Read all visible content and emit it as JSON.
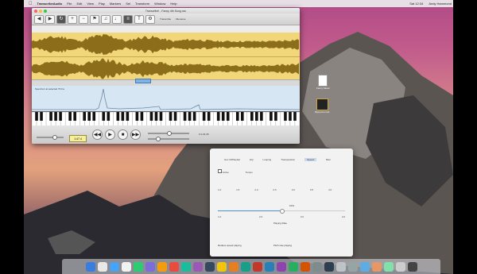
{
  "menubar": {
    "app_name": "TranscribeAudio",
    "items": [
      "File",
      "Edit",
      "View",
      "Play",
      "Markers",
      "Sel",
      "Transform",
      "Window",
      "Help"
    ],
    "status": [
      "Sat 12:34",
      "Andy Hammond"
    ]
  },
  "window": {
    "title": "Transcribe! - Fancy 4th Song.xsc",
    "toolbar_text": [
      "Transcribe",
      "Filename"
    ],
    "spectrum_label": "Spectrum at selected 79 Fa",
    "note_labels": [
      "C4",
      "C5",
      "C6"
    ],
    "readout": "0:1:23.45",
    "lcd": "1:47.4"
  },
  "desktop": {
    "icon1_label": "Fancy Music",
    "icon2_label": "MyLyrics.mp4"
  },
  "panel": {
    "tabs": [
      "Get CDPlaybar",
      "EQ",
      "Looping",
      "Transposition",
      "Speed",
      "Misc"
    ],
    "selected_tab": "Speed",
    "mode_label": "Active",
    "value_label": "Tempo",
    "slider_value": 0.5,
    "row_labels": [
      "1.0",
      "1.5",
      "2.0",
      "2.5",
      "3.0",
      "3.5",
      "4.0"
    ],
    "slider_caption": "Playing Rate",
    "footer_left": "Reduce speed playing",
    "footer_right": "Pitch rate playing",
    "fraction_label": "10%"
  },
  "colors": {
    "wave": "#f1d77a",
    "waveform": "#8c6d1a",
    "spectrum_bg": "#d6e6f3"
  }
}
